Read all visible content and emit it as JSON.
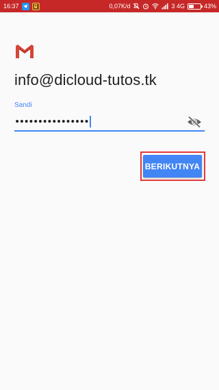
{
  "status_bar": {
    "time": "16:37",
    "network_speed": "0,07K/d",
    "network_type": "3 4G",
    "battery_percent": "43%",
    "battery_level": 0.43,
    "icons": [
      "telegram-icon",
      "game-icon",
      "mute-icon",
      "alarm-icon",
      "wifi-icon",
      "signal-icon",
      "battery-icon"
    ],
    "color": "#c62828"
  },
  "login": {
    "logo": "gmail-icon",
    "email": "info@dicloud-tutos.tk",
    "password_label": "Sandi",
    "password_value": "••••••••••••••••",
    "visibility_icon": "eye-off-icon",
    "next_label": "BERIKUTNYA",
    "accent_color": "#4285f4",
    "highlight_color": "#e53935"
  }
}
